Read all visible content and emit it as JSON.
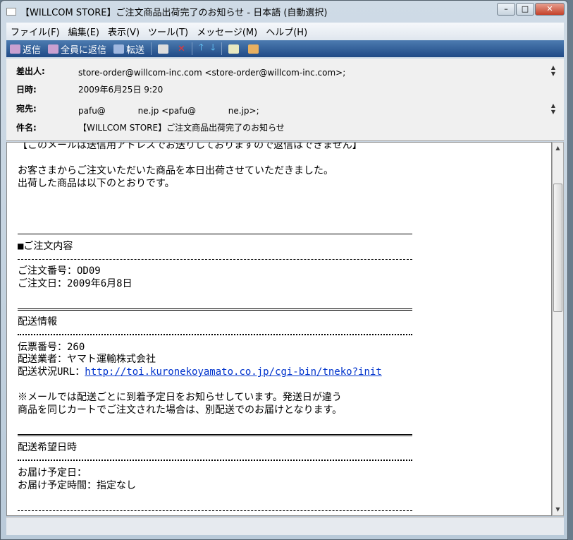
{
  "window": {
    "title": "【WILLCOM STORE】ご注文商品出荷完了のお知らせ - 日本語 (自動選択)"
  },
  "menu": [
    "ファイル(F)",
    "編集(E)",
    "表示(V)",
    "ツール(T)",
    "メッセージ(M)",
    "ヘルプ(H)"
  ],
  "toolbar": {
    "reply": "返信",
    "reply_all": "全員に返信",
    "forward": "転送"
  },
  "header": {
    "from_label": "差出人:",
    "from": "store-order@willcom-inc.com <store-order@willcom-inc.com>;",
    "date_label": "日時:",
    "date": "2009年6月25日 9:20",
    "to_label": "宛先:",
    "to": "pafu@            ne.jp <pafu@            ne.jp>;",
    "subject_label": "件名:",
    "subject": "【WILLCOM STORE】ご注文商品出荷完了のお知らせ"
  },
  "body": {
    "notice": "【このメールは送信用アドレスでお送りしておりますので返信はできません】",
    "intro1": "お客さまからご注文いただいた商品を本日出荷させていただきました。",
    "intro2": "出荷した商品は以下のとおりです。",
    "order_heading": "■ご注文内容",
    "order_number": "ご注文番号：OD09",
    "order_date": "ご注文日：2009年6月8日",
    "shipping_heading": "配送情報",
    "slip_number": "伝票番号：260",
    "carrier": "配送業者：ヤマト運輸株式会社",
    "status_url_label": "配送状況URL：",
    "status_url": "http://toi.kuronekoyamato.co.jp/cgi-bin/tneko?init",
    "note1": "※メールでは配送ごとに到着予定日をお知らせしています。発送日が違う",
    "note2": "商品を同じカートでご注文された場合は、別配送でのお届けとなります。",
    "delivery_heading": "配送希望日時",
    "delivery_date": "お届け予定日：",
    "delivery_time": "お届け予定時間：指定なし"
  }
}
